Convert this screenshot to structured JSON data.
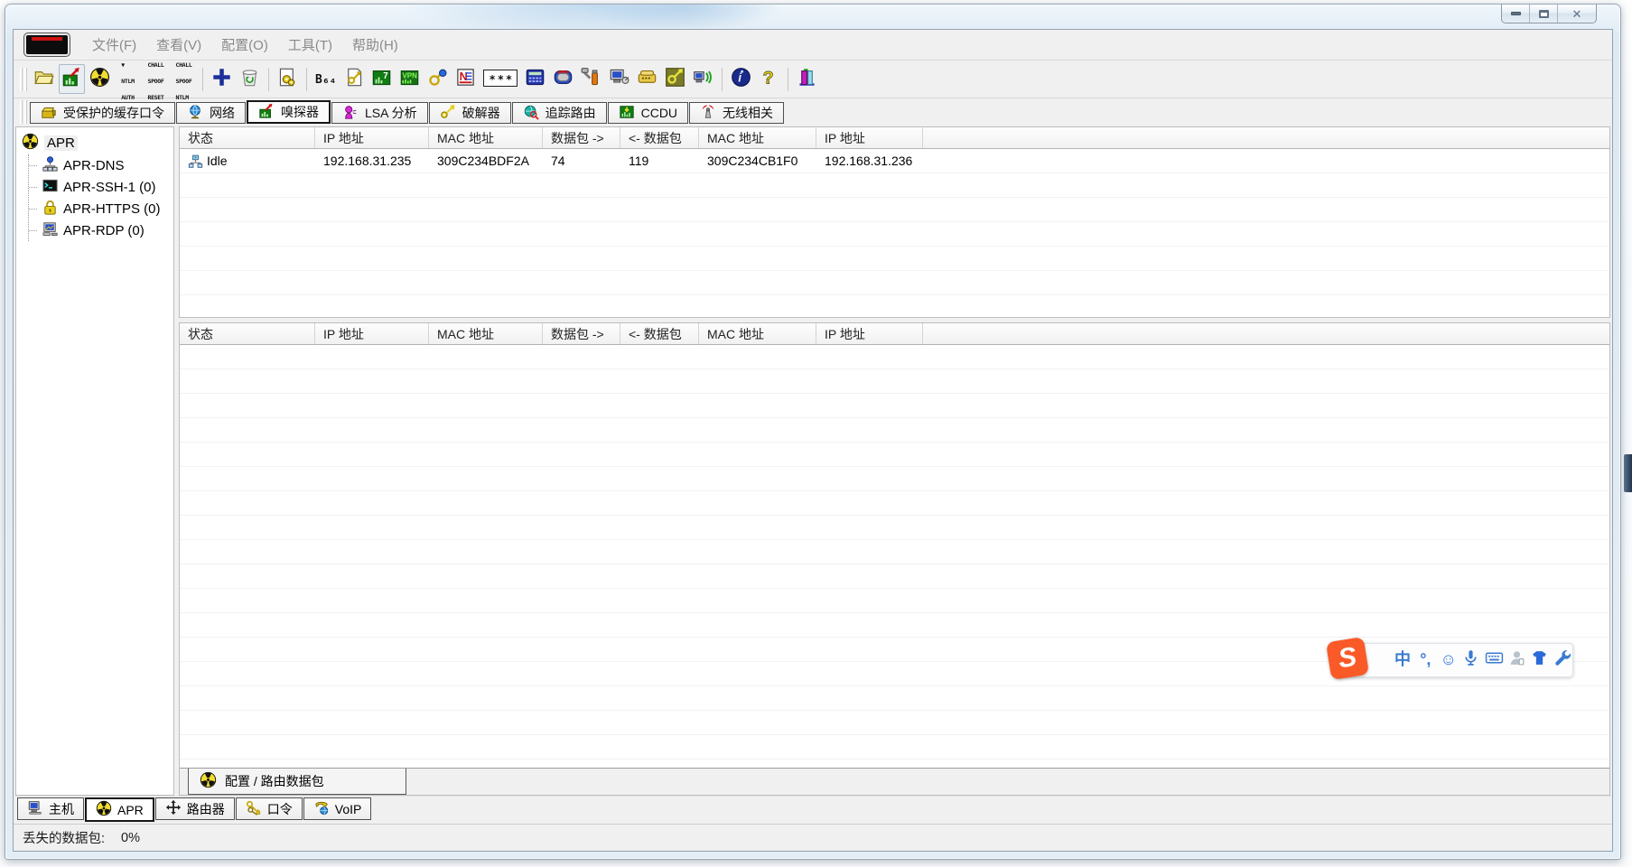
{
  "colors": {
    "accent_blue": "#3a7ad0",
    "sogou_orange": "#fa5a28",
    "apr_yellow": "#f2dd2e",
    "chart_green": "#0f7d12"
  },
  "menu_bar": {
    "items": [
      {
        "name": "menu-file",
        "label": "文件(F)"
      },
      {
        "name": "menu-view",
        "label": "查看(V)"
      },
      {
        "name": "menu-configure",
        "label": "配置(O)"
      },
      {
        "name": "menu-tools",
        "label": "工具(T)"
      },
      {
        "name": "menu-help",
        "label": "帮助(H)"
      }
    ]
  },
  "toolbar": {
    "buttons": [
      {
        "name": "open-button",
        "icon": "open-folder-icon"
      },
      {
        "name": "start-stop-sniffer-button",
        "icon": "start-sniffer-icon",
        "pressed": true
      },
      {
        "name": "start-stop-apr-button",
        "icon": "apr-radioactive-icon"
      },
      {
        "name": "ntlm-auth-button",
        "text": "▼\nNTLM\nAUTH"
      },
      {
        "name": "chall-spoof-reset-button",
        "text": "CHALL\nSPOOF\nRESET"
      },
      {
        "name": "chall-spoof-ntlm-button",
        "text": "CHALL\nSPOOF\nNTLM"
      },
      {
        "separator": true
      },
      {
        "name": "add-to-list-button",
        "icon": "add-icon"
      },
      {
        "name": "remove-button",
        "icon": "remove-icon"
      },
      {
        "separator": true
      },
      {
        "name": "configure-button",
        "icon": "network-config-icon"
      },
      {
        "separator": true
      },
      {
        "name": "base64-decoder-button",
        "text": "B₆₄",
        "style": "b64"
      },
      {
        "name": "cisco-type7-decoder-button",
        "icon": "key-page-icon"
      },
      {
        "name": "hash-calculator-button",
        "icon": "hash-calculator-icon"
      },
      {
        "name": "vpn-decoder-button",
        "icon": "vpn-icon"
      },
      {
        "name": "wireless-keys-button",
        "icon": "wireless-key-icon"
      },
      {
        "name": "cisco-config-decoder-button",
        "icon": "cisco-decoder-icon"
      },
      {
        "name": "password-decoder-button",
        "text": "***",
        "style": "boxed"
      },
      {
        "name": "calculator-button",
        "icon": "calculator-icon"
      },
      {
        "name": "securid-token-button",
        "icon": "securid-token-icon"
      },
      {
        "name": "injector-button",
        "icon": "injector-icon"
      },
      {
        "name": "remote-desktop-button",
        "icon": "remote-desktop-icon"
      },
      {
        "name": "modem-decoder-button",
        "icon": "modem-icon"
      },
      {
        "name": "cisco-vpn-key-button",
        "icon": "cisco-vpn-key-icon"
      },
      {
        "name": "wireless-scanner-button",
        "icon": "wireless-scanner-icon"
      },
      {
        "separator": true
      },
      {
        "name": "about-button",
        "icon": "about-icon"
      },
      {
        "name": "help-button",
        "icon": "help-icon"
      },
      {
        "separator": true
      },
      {
        "name": "exit-button",
        "icon": "exit-icon"
      }
    ]
  },
  "mode_tabs": {
    "tabs": [
      {
        "name": "tab-protected-storage",
        "icon": "protected-storage-icon",
        "label": "受保护的缓存口令"
      },
      {
        "name": "tab-network",
        "icon": "network-tab-icon",
        "label": "网络"
      },
      {
        "name": "tab-sniffer",
        "icon": "start-sniffer-icon",
        "label": "嗅探器",
        "active": true
      },
      {
        "name": "tab-lsa-secrets",
        "icon": "lsa-secrets-icon",
        "label": "LSA 分析"
      },
      {
        "name": "tab-cracker",
        "icon": "cracker-icon",
        "label": "破解器"
      },
      {
        "name": "tab-traceroute",
        "icon": "traceroute-icon",
        "label": "追踪路由"
      },
      {
        "name": "tab-ccdu",
        "icon": "ccdu-icon",
        "label": "CCDU"
      },
      {
        "name": "tab-wireless",
        "icon": "wireless-tab-icon",
        "label": "无线相关"
      }
    ]
  },
  "sniffer": {
    "tree": {
      "root": {
        "name": "tree-item-apr",
        "icon": "apr-radioactive-icon",
        "label": "APR"
      },
      "children": [
        {
          "name": "tree-item-apr-dns",
          "icon": "dns-icon",
          "label": "APR-DNS"
        },
        {
          "name": "tree-item-apr-ssh",
          "icon": "ssh-icon",
          "label": "APR-SSH-1 (0)"
        },
        {
          "name": "tree-item-apr-https",
          "icon": "https-icon",
          "label": "APR-HTTPS (0)"
        },
        {
          "name": "tree-item-apr-rdp",
          "icon": "rdp-icon",
          "label": "APR-RDP (0)"
        }
      ]
    },
    "columns": [
      {
        "label": "状态"
      },
      {
        "label": "IP 地址"
      },
      {
        "label": "MAC 地址"
      },
      {
        "label": "数据包 ->"
      },
      {
        "label": "<- 数据包"
      },
      {
        "label": "MAC 地址"
      },
      {
        "label": "IP 地址"
      }
    ],
    "upper_table_rows": [
      {
        "name": "apr-entry-row",
        "icon": "host-route-icon",
        "cells": [
          "Idle",
          "192.168.31.235",
          "309C234BDF2A",
          "74",
          "119",
          "309C234CB1F0",
          "192.168.31.236"
        ]
      }
    ],
    "lower_table_rows": [],
    "inner_tab": {
      "name": "inner-tab-configuration",
      "icon": "apr-radioactive-icon",
      "label": "配置 / 路由数据包"
    }
  },
  "bottom_tabs": {
    "tabs": [
      {
        "name": "bottom-tab-hosts",
        "icon": "hosts-icon",
        "label": "主机"
      },
      {
        "name": "bottom-tab-apr",
        "icon": "apr-radioactive-icon",
        "label": "APR",
        "active": true
      },
      {
        "name": "bottom-tab-routing",
        "icon": "routing-icon",
        "label": "路由器"
      },
      {
        "name": "bottom-tab-passwords",
        "icon": "passwords-icon",
        "label": "口令"
      },
      {
        "name": "bottom-tab-voip",
        "icon": "voip-icon",
        "label": "VoIP"
      }
    ]
  },
  "status_bar": {
    "label": "丢失的数据包:",
    "value": "0%"
  },
  "ime_bar": {
    "buttons": [
      {
        "name": "sogou-logo-icon",
        "glyph": "S",
        "style": "slogo"
      },
      {
        "name": "chinese-mode-icon",
        "glyph": "中"
      },
      {
        "name": "punctuation-icon",
        "glyph": "°,"
      },
      {
        "name": "emoji-icon",
        "glyph": "☺"
      },
      {
        "name": "voice-input-icon"
      },
      {
        "name": "soft-keyboard-icon"
      },
      {
        "name": "account-icon"
      },
      {
        "name": "skin-icon"
      },
      {
        "name": "settings-wrench-icon"
      }
    ]
  }
}
